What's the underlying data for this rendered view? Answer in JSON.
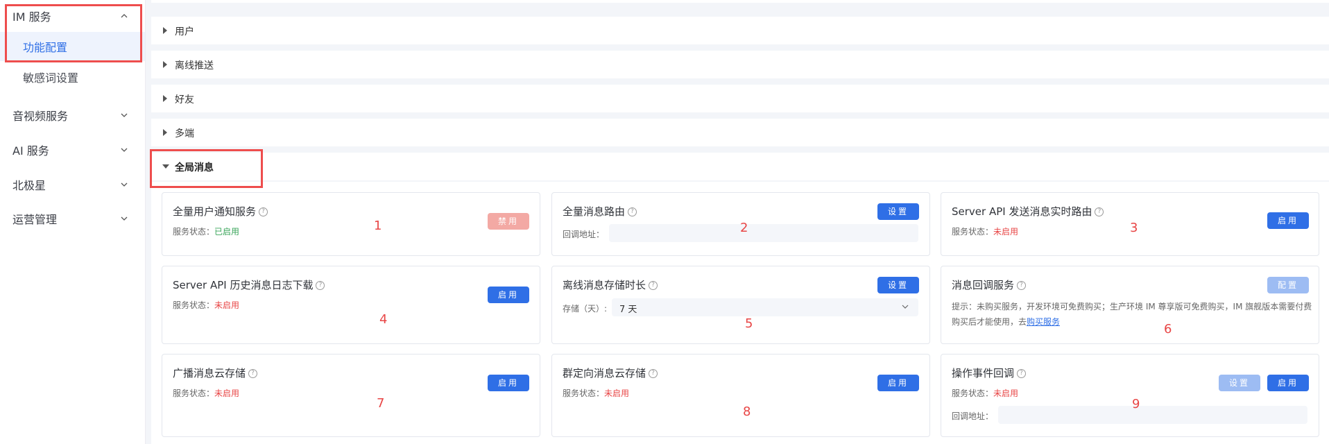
{
  "sidebar": {
    "groups": [
      {
        "label": "IM 服务",
        "expanded": true
      },
      {
        "label": "音视频服务"
      },
      {
        "label": "AI 服务"
      },
      {
        "label": "北极星"
      },
      {
        "label": "运营管理"
      }
    ],
    "sub_items": [
      {
        "label": "功能配置",
        "active": true
      },
      {
        "label": "敏感词设置"
      }
    ]
  },
  "sections": [
    {
      "label": "用户",
      "expanded": false
    },
    {
      "label": "离线推送",
      "expanded": false
    },
    {
      "label": "好友",
      "expanded": false
    },
    {
      "label": "多端",
      "expanded": false
    },
    {
      "label": "全局消息",
      "expanded": true
    }
  ],
  "cards": [
    {
      "title": "全量用户通知服务",
      "status_label": "服务状态：",
      "status": "已启用",
      "button": "禁用",
      "marker": "1"
    },
    {
      "title": "全量消息路由",
      "field_label": "回调地址：",
      "field_value": "",
      "button": "设置",
      "marker": "2"
    },
    {
      "title": "Server API 发送消息实时路由",
      "status_label": "服务状态：",
      "status": "未启用",
      "button": "启用",
      "marker": "3"
    },
    {
      "title": "Server API 历史消息日志下载",
      "status_label": "服务状态：",
      "status": "未启用",
      "button": "启用",
      "marker": "4"
    },
    {
      "title": "离线消息存储时长",
      "field_label": "存储（天）:",
      "select_value": "7 天",
      "button": "设置",
      "marker": "5"
    },
    {
      "title": "消息回调服务",
      "tip": "提示：未购买服务，开发环境可免费购买；生产环境 IM 尊享版可免费购买，IM 旗舰版本需要付费购买后才能使用，去",
      "tip_link": "购买服务",
      "button": "配置",
      "marker": "6"
    },
    {
      "title": "广播消息云存储",
      "status_label": "服务状态：",
      "status": "未启用",
      "button": "启用",
      "marker": "7"
    },
    {
      "title": "群定向消息云存储",
      "status_label": "服务状态：",
      "status": "未启用",
      "button": "启用",
      "marker": "8"
    },
    {
      "title": "操作事件回调",
      "status_label": "服务状态：",
      "status": "未启用",
      "field_label": "回调地址：",
      "field_value": "",
      "button": "设置",
      "button2": "启用",
      "marker": "9"
    }
  ],
  "colors": {
    "accent": "#2f6fe6",
    "enabled": "#3aa55a",
    "disabled": "#e84545",
    "highlight_box": "#ee4d4d"
  }
}
